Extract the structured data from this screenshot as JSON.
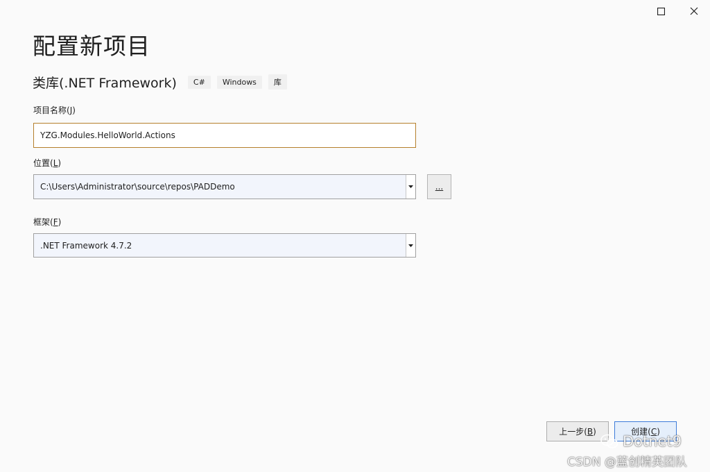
{
  "window": {
    "maximize_icon": "maximize-icon",
    "close_icon": "close-icon"
  },
  "header": {
    "title": "配置新项目",
    "template_name": "类库(.NET Framework)",
    "tags": [
      "C#",
      "Windows",
      "库"
    ]
  },
  "form": {
    "project_name": {
      "label": "项目名称",
      "access_key": "J",
      "value": "YZG.Modules.HelloWorld.Actions"
    },
    "location": {
      "label": "位置",
      "access_key": "L",
      "value": "C:\\Users\\Administrator\\source\\repos\\PADDemo",
      "browse_label": "..."
    },
    "framework": {
      "label": "框架",
      "access_key": "F",
      "value": ".NET Framework 4.7.2"
    }
  },
  "footer": {
    "back": {
      "label": "上一步",
      "access_key": "B"
    },
    "create": {
      "label": "创建",
      "access_key": "C"
    }
  },
  "watermark": {
    "line1": "Dotnet9",
    "line2": "CSDN @蓝创精英团队",
    "icon": "wechat-icon"
  },
  "colors": {
    "background": "#fafafa",
    "focus_border": "#b57f2b",
    "default_button_border": "#3d7bd9"
  }
}
